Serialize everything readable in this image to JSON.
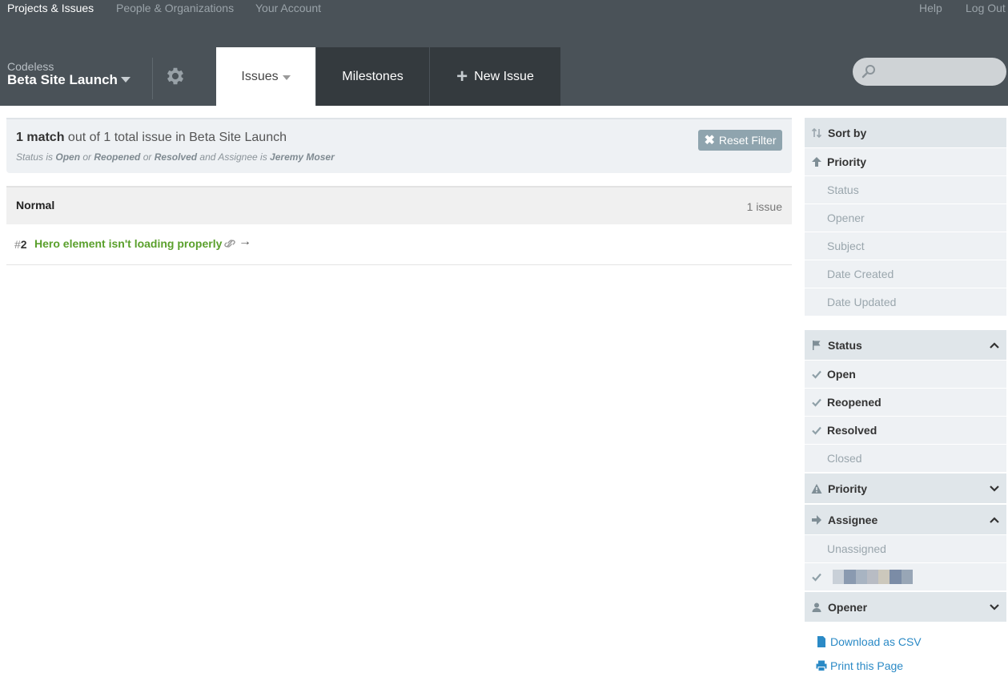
{
  "topnav": {
    "projects": "Projects & Issues",
    "people": "People & Organizations",
    "account": "Your Account",
    "help": "Help",
    "logout": "Log Out"
  },
  "project": {
    "org": "Codeless",
    "title": "Beta Site Launch"
  },
  "tabs": {
    "issues": "Issues",
    "milestones": "Milestones",
    "new_issue": "New Issue"
  },
  "search": {
    "placeholder": ""
  },
  "filter": {
    "match_strong": "1 match",
    "match_rest": " out of 1 total issue in Beta Site Launch",
    "desc": {
      "p1": "Status is ",
      "s1": "Open",
      "p2": " or ",
      "s2": "Reopened",
      "p3": " or ",
      "s3": "Resolved",
      "p4": " and Assignee is ",
      "s4": "Jeremy Moser"
    },
    "reset_label": "Reset Filter"
  },
  "group": {
    "name": "Normal",
    "count": "1 issue"
  },
  "issue": {
    "hash": "#",
    "number": "2",
    "title": "Hero element isn't loading properly",
    "arrow": "→"
  },
  "sidebar": {
    "sort_by": "Sort by",
    "sort_items": [
      "Priority",
      "Status",
      "Opener",
      "Subject",
      "Date Created",
      "Date Updated"
    ],
    "status": "Status",
    "status_items": [
      "Open",
      "Reopened",
      "Resolved",
      "Closed"
    ],
    "priority": "Priority",
    "assignee": "Assignee",
    "assignee_items": [
      "Unassigned"
    ],
    "opener": "Opener"
  },
  "tools": {
    "csv": "Download as CSV",
    "print": "Print this Page"
  },
  "colors": {
    "header": "#4a5258",
    "tab_dark": "#343a3e",
    "accent_green": "#5aa02c",
    "link_blue": "#2b8ac6",
    "reset": "#8fa4ae"
  }
}
